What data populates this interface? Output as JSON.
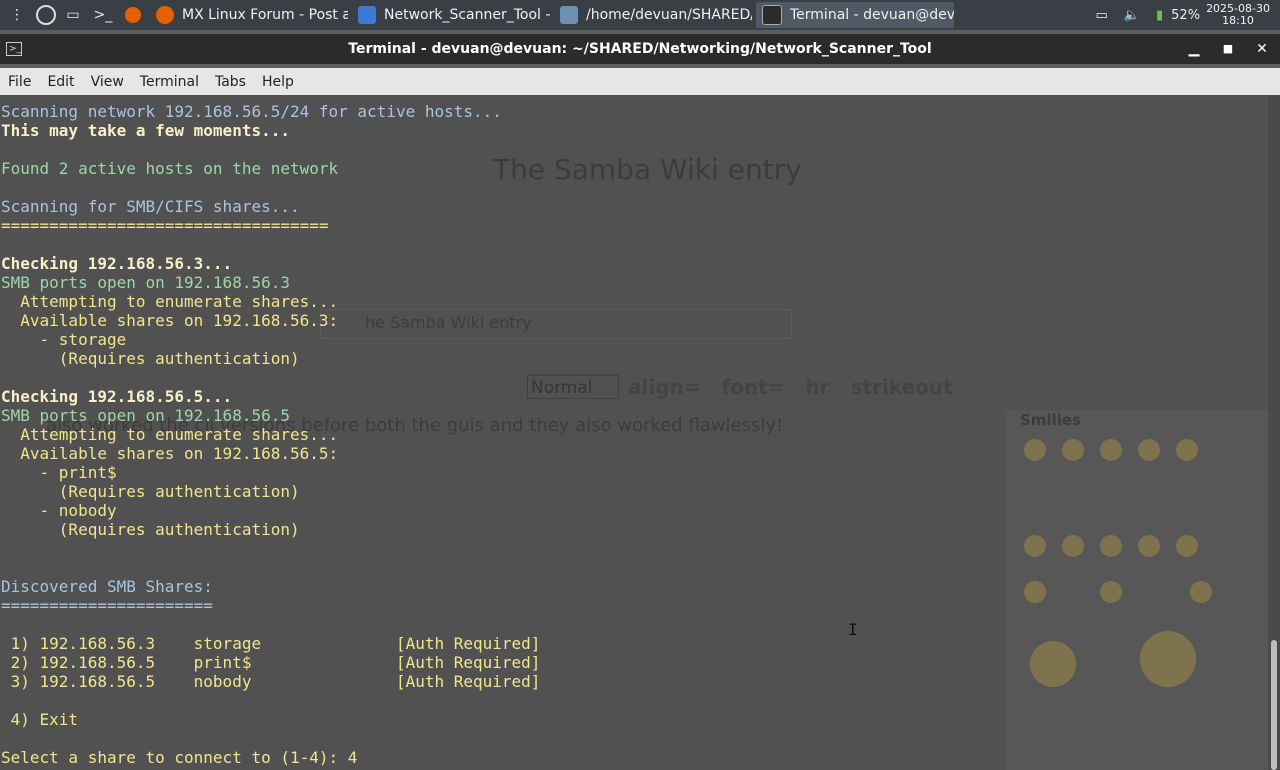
{
  "taskbar": {
    "tasks": [
      {
        "label": "MX Linux Forum - Post a ...",
        "icon": "firefox-icon",
        "color": "#e66000"
      },
      {
        "label": "Network_Scanner_Tool - ...",
        "icon": "folder-icon",
        "color": "#3b7bd6"
      },
      {
        "label": "/home/devuan/SHARED/...",
        "icon": "editor-icon",
        "color": "#6d8fb3"
      },
      {
        "label": "Terminal - devuan@devu...",
        "icon": "terminal-icon",
        "color": "#2b2b2b"
      }
    ],
    "battery": "52%",
    "date": "2025-08-30",
    "time": "18:10"
  },
  "window": {
    "title": "Terminal - devuan@devuan: ~/SHARED/Networking/Network_Scanner_Tool",
    "min": "▁",
    "max": "■",
    "close": "✕"
  },
  "menubar": [
    "File",
    "Edit",
    "View",
    "Terminal",
    "Tabs",
    "Help"
  ],
  "terminal": {
    "lines": [
      {
        "text": "Scanning network 192.168.56.5/24 for active hosts...",
        "style": "blue"
      },
      {
        "text": "This may take a few moments...",
        "style": "bold"
      },
      {
        "text": "",
        "style": ""
      },
      {
        "text": "Found 2 active hosts on the network",
        "style": "grn"
      },
      {
        "text": "",
        "style": ""
      },
      {
        "text": "Scanning for SMB/CIFS shares...",
        "style": "blue"
      },
      {
        "text": "==================================",
        "style": "yel"
      },
      {
        "text": "",
        "style": ""
      },
      {
        "text": "Checking 192.168.56.3...",
        "style": "bold"
      },
      {
        "text": "SMB ports open on 192.168.56.3",
        "style": "grn"
      },
      {
        "text": "  Attempting to enumerate shares...",
        "style": "yel"
      },
      {
        "text": "  Available shares on 192.168.56.3:",
        "style": "yel"
      },
      {
        "text": "    - storage",
        "style": "yel"
      },
      {
        "text": "      (Requires authentication)",
        "style": "yel"
      },
      {
        "text": "",
        "style": ""
      },
      {
        "text": "Checking 192.168.56.5...",
        "style": "bold"
      },
      {
        "text": "SMB ports open on 192.168.56.5",
        "style": "grn"
      },
      {
        "text": "  Attempting to enumerate shares...",
        "style": "yel"
      },
      {
        "text": "  Available shares on 192.168.56.5:",
        "style": "yel"
      },
      {
        "text": "    - print$",
        "style": "yel"
      },
      {
        "text": "      (Requires authentication)",
        "style": "yel"
      },
      {
        "text": "    - nobody",
        "style": "yel"
      },
      {
        "text": "      (Requires authentication)",
        "style": "yel"
      },
      {
        "text": "",
        "style": ""
      },
      {
        "text": "",
        "style": ""
      },
      {
        "text": "Discovered SMB Shares:",
        "style": "blue"
      },
      {
        "text": "======================",
        "style": "blue"
      },
      {
        "text": "",
        "style": ""
      },
      {
        "text": " 1) 192.168.56.3    storage              [Auth Required]",
        "style": "yel"
      },
      {
        "text": " 2) 192.168.56.5    print$               [Auth Required]",
        "style": "yel"
      },
      {
        "text": " 3) 192.168.56.5    nobody               [Auth Required]",
        "style": "yel"
      },
      {
        "text": "",
        "style": ""
      },
      {
        "text": " 4) Exit",
        "style": "yel"
      },
      {
        "text": "",
        "style": ""
      },
      {
        "text": "Select a share to connect to (1-4): 4",
        "style": "yel"
      }
    ]
  },
  "background_page": {
    "title": "The Samba Wiki entry",
    "subject": "he Samba Wiki entry",
    "dropdown": "Normal",
    "toolbar": "align= font= hr strikeout",
    "body": "also worked the cli versions before both the guis and they also worked flawlessly!",
    "smilies_label": "Smilies"
  }
}
